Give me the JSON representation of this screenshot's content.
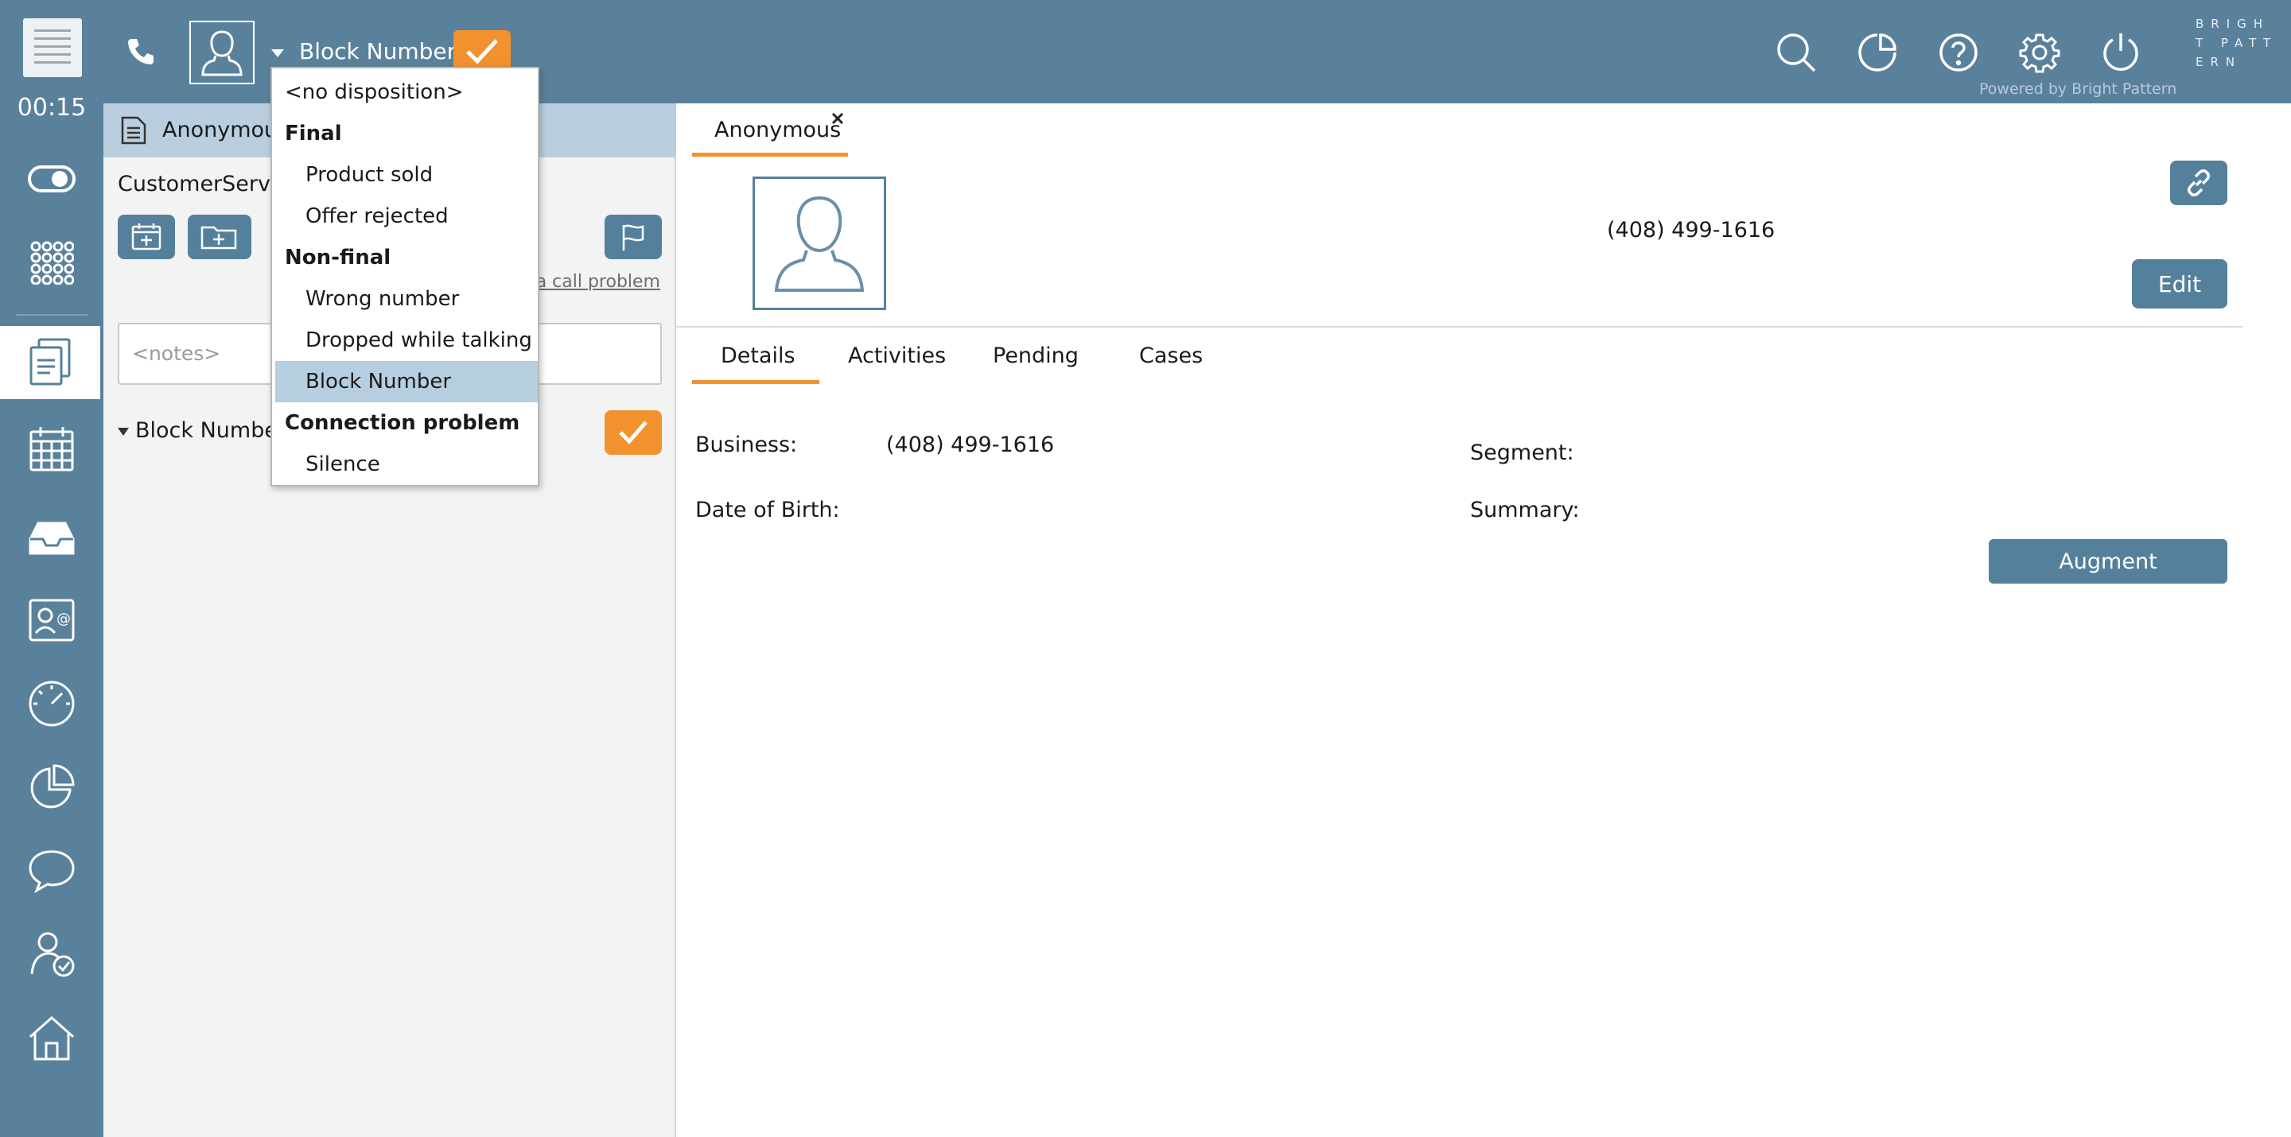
{
  "header": {
    "timer": "00:15",
    "disposition_selected": "Block Number",
    "brand_logo": "BRIGHT PATTERN",
    "powered_by": "Powered by Bright Pattern"
  },
  "dispositions": {
    "items": [
      {
        "label": "<no disposition>",
        "kind": "plain"
      },
      {
        "label": "Final",
        "kind": "hdr"
      },
      {
        "label": "Product sold",
        "kind": "opt"
      },
      {
        "label": "Offer rejected",
        "kind": "opt"
      },
      {
        "label": "Non-final",
        "kind": "hdr"
      },
      {
        "label": "Wrong number",
        "kind": "opt"
      },
      {
        "label": "Dropped while talking",
        "kind": "opt"
      },
      {
        "label": "Block Number",
        "kind": "sel"
      },
      {
        "label": "Connection problem",
        "kind": "hdr"
      },
      {
        "label": "Silence",
        "kind": "opt"
      }
    ]
  },
  "panel": {
    "tab_title": "Anonymous",
    "service": "CustomerService",
    "report_link": "Report a call problem",
    "notes_placeholder": "<notes>",
    "disposition_label": "Block Number"
  },
  "contact": {
    "tab_name": "Anonymous",
    "phone": "(408) 499-1616",
    "edit_label": "Edit",
    "tabs": [
      "Details",
      "Activities",
      "Pending",
      "Cases"
    ],
    "business_label": "Business:",
    "business_value": "(408) 499-1616",
    "dob_label": "Date of Birth:",
    "segment_label": "Segment:",
    "summary_label": "Summary:",
    "augment_label": "Augment"
  },
  "colors": {
    "sidebar": "#5a819c",
    "accent": "#f2922e",
    "button": "#55809b",
    "selected_item": "#b6cfe0"
  }
}
